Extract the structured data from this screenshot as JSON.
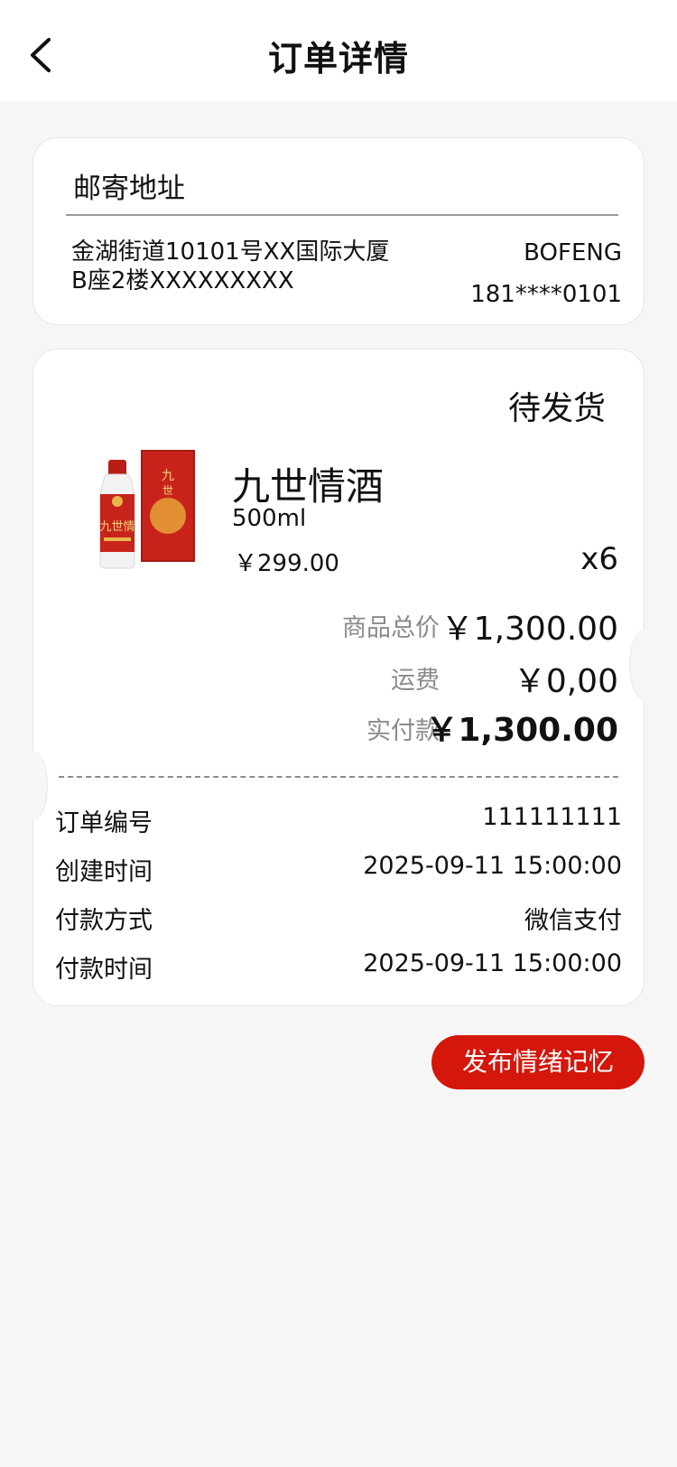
{
  "header": {
    "title": "订单详情"
  },
  "address": {
    "section_title": "邮寄地址",
    "line1": "金湖街道10101号XX国际大厦",
    "line2": "B座2楼XXXXXXXXX",
    "recipient": "BOFENG",
    "phone": "181****0101"
  },
  "order": {
    "status": "待发货",
    "product": {
      "name": "九世情酒",
      "spec": "500ml",
      "price": "￥299.00",
      "quantity": "x6",
      "label_text": "九世情"
    },
    "summary": [
      {
        "label": "商品总价",
        "value": "￥1,300.00"
      },
      {
        "label": "运费",
        "value": "￥0,00"
      },
      {
        "label": "实付款",
        "value": "￥1,300.00"
      }
    ],
    "info": [
      {
        "label": "订单编号",
        "value": "111111111"
      },
      {
        "label": "创建时间",
        "value": "2025-09-11 15:00:00"
      },
      {
        "label": "付款方式",
        "value": "微信支付"
      },
      {
        "label": "付款时间",
        "value": "2025-09-11 15:00:00"
      }
    ]
  },
  "actions": {
    "publish_label": "发布情绪记忆"
  },
  "colors": {
    "accent": "#d4160b",
    "background": "#f6f6f6",
    "card": "#ffffff",
    "muted_text": "#8a8a8a"
  }
}
